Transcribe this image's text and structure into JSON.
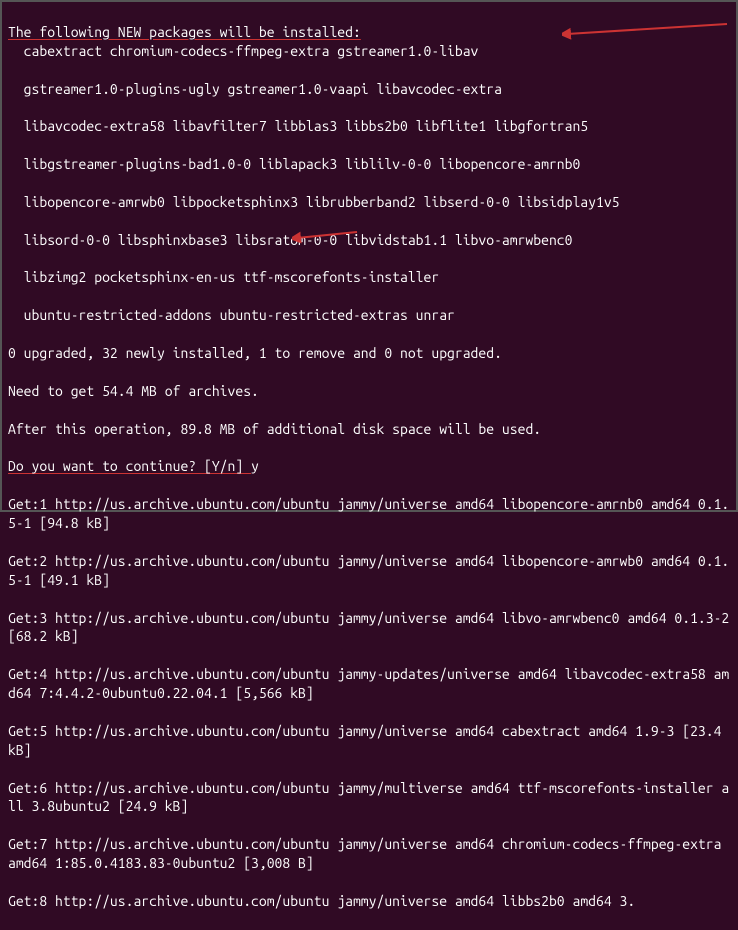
{
  "header": "The following NEW packages will be installed:",
  "packages": {
    "line1": "cabextract chromium-codecs-ffmpeg-extra gstreamer1.0-libav",
    "line2": "gstreamer1.0-plugins-ugly gstreamer1.0-vaapi libavcodec-extra",
    "line3": "libavcodec-extra58 libavfilter7 libblas3 libbs2b0 libflite1 libgfortran5",
    "line4": "libgstreamer-plugins-bad1.0-0 liblapack3 liblilv-0-0 libopencore-amrnb0",
    "line5": "libopencore-amrwb0 libpocketsphinx3 librubberband2 libserd-0-0 libsidplay1v5",
    "line6": "libsord-0-0 libsphinxbase3 libsratom-0-0 libvidstab1.1 libvo-amrwbenc0",
    "line7": "libzimg2 pocketsphinx-en-us ttf-mscorefonts-installer",
    "line8": "ubuntu-restricted-addons ubuntu-restricted-extras unrar"
  },
  "summary": "0 upgraded, 32 newly installed, 1 to remove and 0 not upgraded.",
  "need_to_get": "Need to get 54.4 MB of archives.",
  "after_op": "After this operation, 89.8 MB of additional disk space will be used.",
  "prompt": "Do you want to continue? [Y/n] ",
  "prompt_answer": "y",
  "downloads": {
    "d1": "Get:1 http://us.archive.ubuntu.com/ubuntu jammy/universe amd64 libopencore-amrnb0 amd64 0.1.5-1 [94.8 kB]",
    "d2": "Get:2 http://us.archive.ubuntu.com/ubuntu jammy/universe amd64 libopencore-amrwb0 amd64 0.1.5-1 [49.1 kB]",
    "d3": "Get:3 http://us.archive.ubuntu.com/ubuntu jammy/universe amd64 libvo-amrwbenc0 amd64 0.1.3-2 [68.2 kB]",
    "d4": "Get:4 http://us.archive.ubuntu.com/ubuntu jammy-updates/universe amd64 libavcodec-extra58 amd64 7:4.4.2-0ubuntu0.22.04.1 [5,566 kB]",
    "d5": "Get:5 http://us.archive.ubuntu.com/ubuntu jammy/universe amd64 cabextract amd64 1.9-3 [23.4 kB]",
    "d6": "Get:6 http://us.archive.ubuntu.com/ubuntu jammy/multiverse amd64 ttf-mscorefonts-installer all 3.8ubuntu2 [24.9 kB]",
    "d7": "Get:7 http://us.archive.ubuntu.com/ubuntu jammy/universe amd64 chromium-codecs-ffmpeg-extra amd64 1:85.0.4183.83-0ubuntu2 [3,008 B]",
    "d8": "Get:8 http://us.archive.ubuntu.com/ubuntu jammy/universe amd64 libbs2b0 amd64 3."
  }
}
